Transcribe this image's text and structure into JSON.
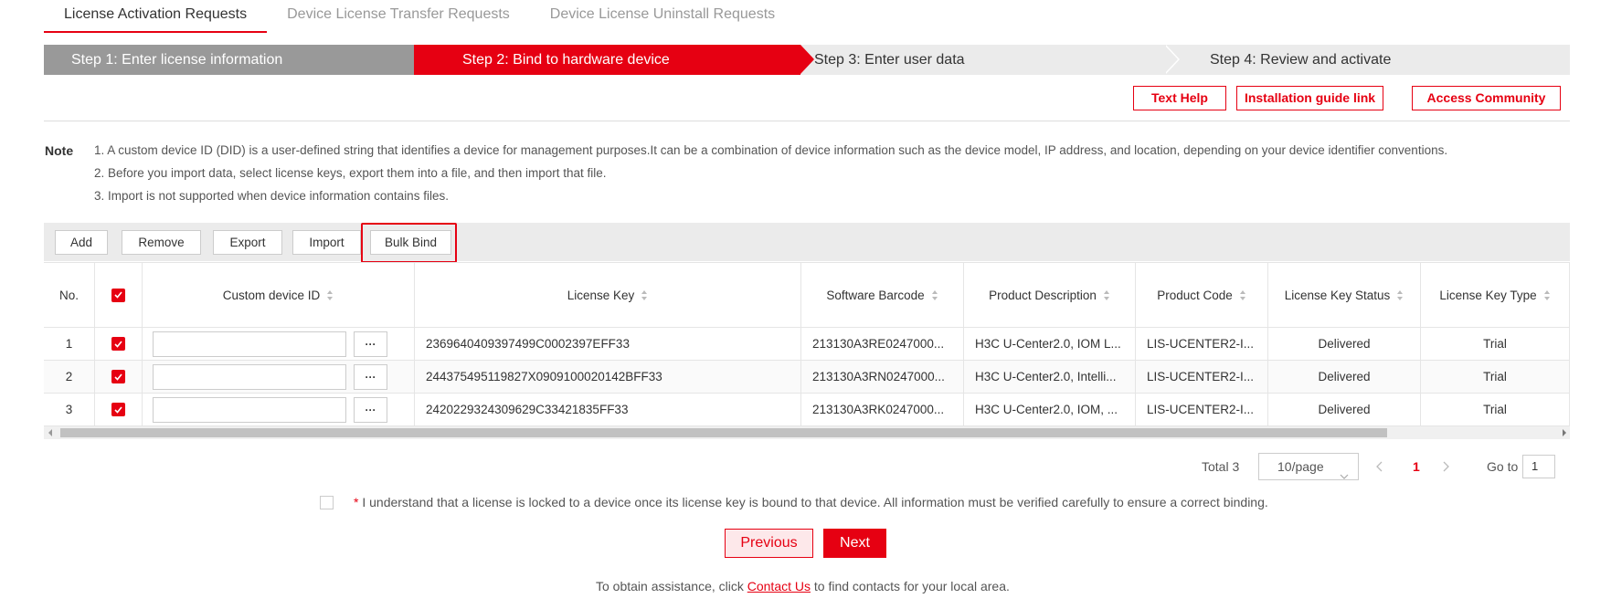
{
  "tabs": [
    {
      "label": "License Activation Requests"
    },
    {
      "label": "Device License Transfer Requests"
    },
    {
      "label": "Device License Uninstall Requests"
    }
  ],
  "steps": [
    {
      "label": "Step 1: Enter license information",
      "state": "done"
    },
    {
      "label": "Step 2: Bind to hardware device",
      "state": "active"
    },
    {
      "label": "Step 3: Enter user data",
      "state": "pending"
    },
    {
      "label": "Step 4: Review and activate",
      "state": "pending"
    }
  ],
  "help_buttons": {
    "text_help": "Text Help",
    "install_guide": "Installation guide link",
    "community": "Access Community"
  },
  "note": {
    "title": "Note",
    "lines": [
      "1. A custom device ID (DID) is a user-defined string that identifies a device for management purposes.It can be a combination of device information such as the device model, IP address, and location, depending on your device identifier conventions.",
      "2. Before you import data, select license keys, export them into a file, and then import that file.",
      "3. Import is not supported when device information contains files."
    ]
  },
  "toolbar": {
    "add": "Add",
    "remove": "Remove",
    "export": "Export",
    "import": "Import",
    "bulk_bind": "Bulk Bind"
  },
  "table": {
    "headers": {
      "no": "No.",
      "did": "Custom device ID",
      "key": "License Key",
      "barcode": "Software Barcode",
      "desc": "Product Description",
      "code": "Product Code",
      "status": "License Key Status",
      "type": "License Key Type"
    },
    "rows": [
      {
        "no": "1",
        "did": "",
        "key": "2369640409397499C0002397EFF33",
        "barcode": "213130A3RE0247000...",
        "desc": "H3C U-Center2.0, IOM L...",
        "code": "LIS-UCENTER2-I...",
        "status": "Delivered",
        "type": "Trial"
      },
      {
        "no": "2",
        "did": "",
        "key": "244375495119827X0909100020142BFF33",
        "barcode": "213130A3RN0247000...",
        "desc": "H3C U-Center2.0, Intelli...",
        "code": "LIS-UCENTER2-I...",
        "status": "Delivered",
        "type": "Trial"
      },
      {
        "no": "3",
        "did": "",
        "key": "2420229324309629C33421835FF33",
        "barcode": "213130A3RK0247000...",
        "desc": "H3C U-Center2.0, IOM, ...",
        "code": "LIS-UCENTER2-I...",
        "status": "Delivered",
        "type": "Trial"
      }
    ],
    "more_glyph": "···"
  },
  "pagination": {
    "total": "Total 3",
    "page_size": "10/page",
    "current": "1",
    "goto_label": "Go to",
    "goto_value": "1"
  },
  "agreement": {
    "star": "*",
    "text": " I understand that a license is locked to a device once its license key is bound to that device. All information must be verified carefully to ensure a correct binding."
  },
  "nav": {
    "previous": "Previous",
    "next": "Next"
  },
  "assist": {
    "before": "To obtain assistance, click ",
    "link": "Contact Us",
    "after": " to find contacts for your local area."
  },
  "colors": {
    "accent": "#e60012",
    "step_done": "#999999",
    "step_pending": "#ebebeb"
  }
}
